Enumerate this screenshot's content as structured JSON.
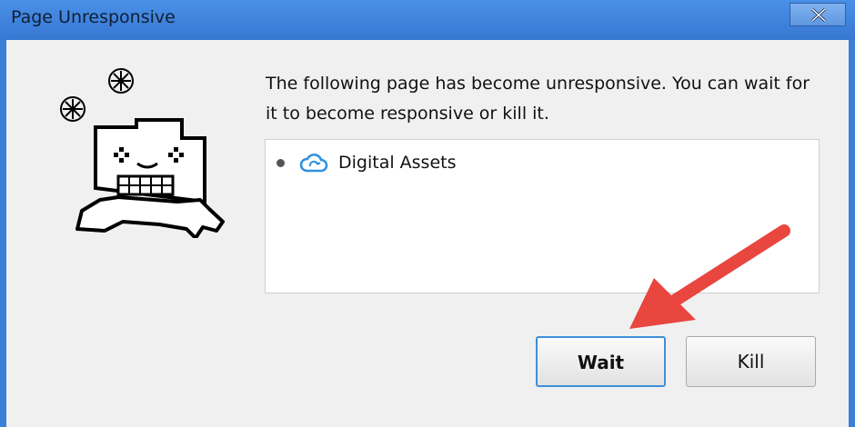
{
  "window": {
    "title": "Page Unresponsive",
    "accent_color": "#3b7fd6",
    "close_icon": "close-icon"
  },
  "dialog": {
    "illustration": "frozen-tab-ghost",
    "message": "The following page has become unresponsive. You can wait for it to become responsive or kill it.",
    "pages": [
      {
        "label": "Digital Assets",
        "icon": "cloud-sync-icon"
      }
    ],
    "buttons": {
      "wait_label": "Wait",
      "kill_label": "Kill"
    }
  },
  "annotation": {
    "arrow_color": "#e8463f",
    "points_to": "wait-button"
  }
}
